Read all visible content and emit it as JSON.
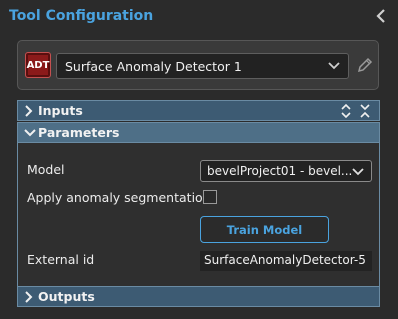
{
  "header": {
    "title": "Tool Configuration",
    "collapse_icon": "chevron-left-icon"
  },
  "tool": {
    "badge": "ADT",
    "selected": "Surface Anomaly Detector 1",
    "edit_icon": "pencil-icon"
  },
  "sections": {
    "inputs": "Inputs",
    "parameters": "Parameters",
    "outputs": "Outputs"
  },
  "parameters": {
    "model_label": "Model",
    "model_value": "bevelProject01 - bevel...",
    "segmentation_label": "Apply anomaly segmentation",
    "segmentation_checked": false,
    "train_button": "Train Model",
    "external_id_label": "External id",
    "external_id_value": "SurfaceAnomalyDetector-5"
  },
  "colors": {
    "accent": "#4aa3df",
    "section_bar": "#4e6f87",
    "badge": "#8b1a1a",
    "background": "#2b2b2b"
  }
}
